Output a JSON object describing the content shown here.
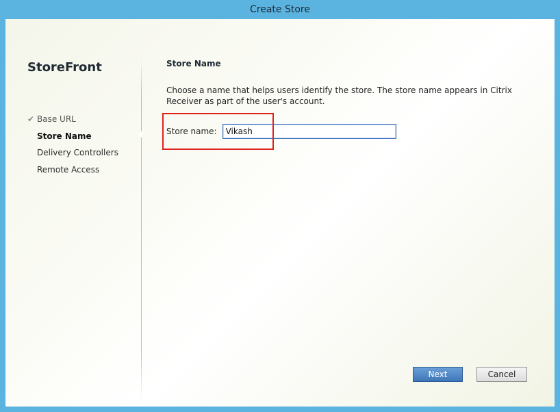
{
  "window": {
    "title": "Create Store"
  },
  "sidebar": {
    "app_title": "StoreFront",
    "items": [
      {
        "label": "Base URL",
        "state": "done"
      },
      {
        "label": "Store Name",
        "state": "active"
      },
      {
        "label": "Delivery Controllers",
        "state": "pending"
      },
      {
        "label": "Remote Access",
        "state": "pending"
      }
    ]
  },
  "main": {
    "section_title": "Store Name",
    "description": "Choose a name that helps users identify the store. The store name appears in Citrix Receiver as part of the user's account.",
    "store_name": {
      "label": "Store name:",
      "value": "Vikash"
    }
  },
  "buttons": {
    "next": "Next",
    "cancel": "Cancel"
  },
  "icons": {
    "check": "checkmark-icon"
  },
  "colors": {
    "title_bar": "#5ab4df",
    "highlight_box": "#e0221c",
    "primary_button": "#3f76b9"
  }
}
